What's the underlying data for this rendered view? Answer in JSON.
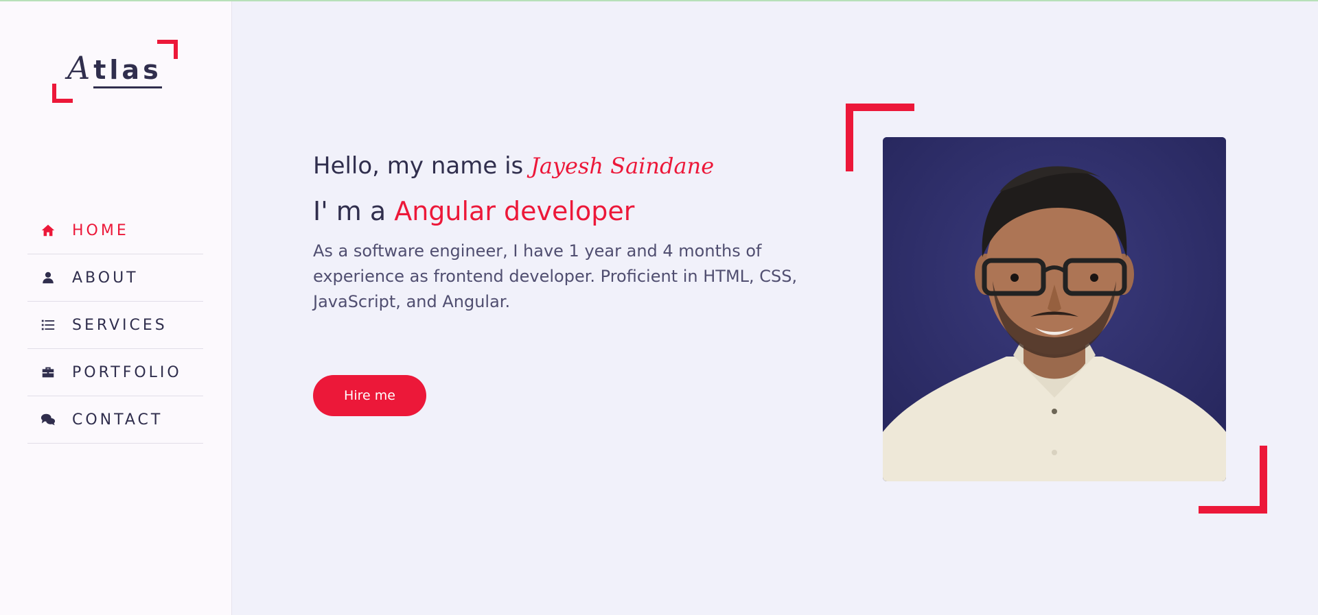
{
  "logo": {
    "first": "A",
    "rest": "tlas"
  },
  "nav": {
    "items": [
      {
        "label": "HOME",
        "icon": "home-icon",
        "active": true
      },
      {
        "label": "ABOUT",
        "icon": "user-icon",
        "active": false
      },
      {
        "label": "SERVICES",
        "icon": "list-icon",
        "active": false
      },
      {
        "label": "PORTFOLIO",
        "icon": "briefcase-icon",
        "active": false
      },
      {
        "label": "CONTACT",
        "icon": "comments-icon",
        "active": false
      }
    ]
  },
  "hero": {
    "greeting_prefix": "Hello, my name is",
    "name": "Jayesh Saindane",
    "role_prefix": "I' m a",
    "role": "Angular developer",
    "bio": "As a software engineer, I have 1 year and 4 months of experience as frontend developer. Proficient in HTML, CSS, JavaScript, and Angular.",
    "button_label": "Hire me"
  },
  "colors": {
    "accent": "#ec1839",
    "text": "#302e4d",
    "background": "#f1f1fa",
    "sidebar": "#fcf9fd"
  }
}
